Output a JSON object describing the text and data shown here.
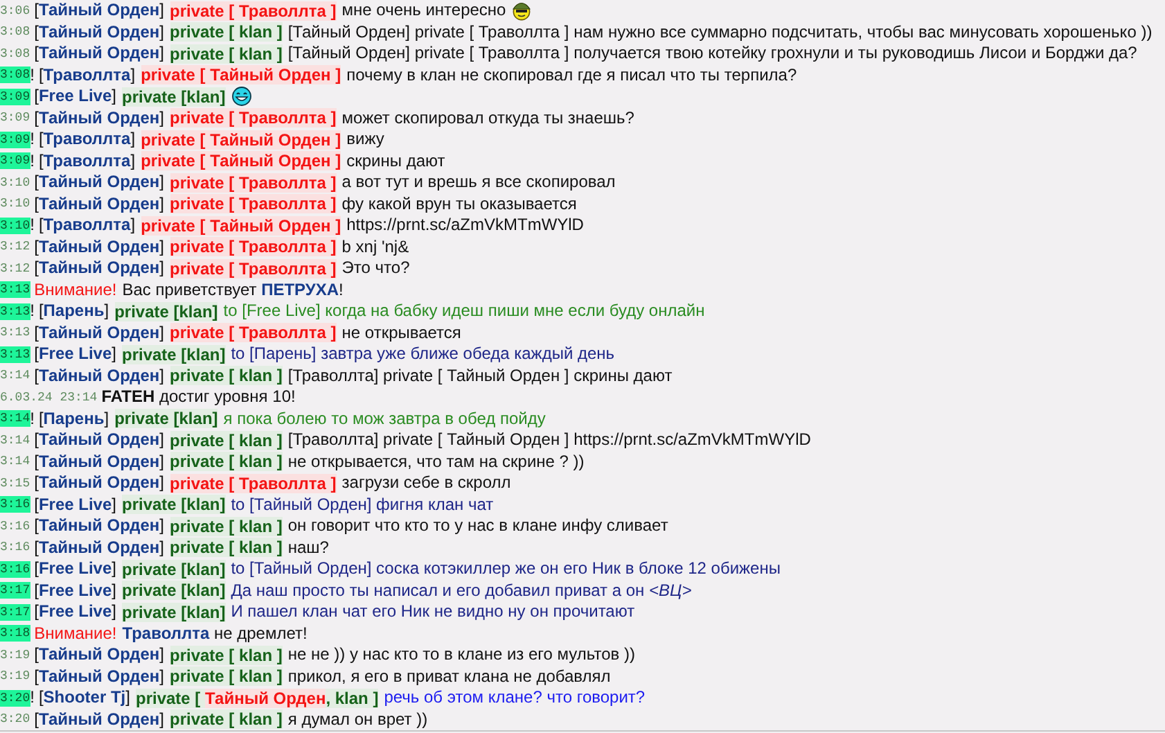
{
  "lines": [
    {
      "time": "3:06",
      "highlighted": false,
      "sender": "[Тайный Орден]",
      "tag": [
        {
          "text": "private [ Траволлта ]",
          "kind": "private"
        }
      ],
      "message": "мне очень интересно",
      "color": "#111111",
      "emoticon": {
        "kind": "helmet"
      }
    },
    {
      "time": "3:08",
      "highlighted": false,
      "sender": "[Тайный Орден]",
      "tag": [
        {
          "text": "private [ klan ]",
          "kind": "klan"
        }
      ],
      "message": "[Тайный Орден] private [ Траволлта ] нам нужно все суммарно подсчитать, чтобы вас минусовать хорошенько ))",
      "color": "#111111"
    },
    {
      "time": "3:08",
      "highlighted": false,
      "sender": "[Тайный Орден]",
      "tag": [
        {
          "text": "private [ klan ]",
          "kind": "klan"
        }
      ],
      "message": "[Тайный Орден] private [ Траволлта ] получается твою котейку грохнули и ты руководишь Лисои и Борджи да?",
      "color": "#111111"
    },
    {
      "time": "3:08",
      "highlighted": true,
      "prefix": "!",
      "sender": "[Траволлта]",
      "tag": [
        {
          "text": "private [ Тайный Орден ]",
          "kind": "private"
        }
      ],
      "message": "почему в клан не скопировал где я писал что ты терпила?",
      "color": "#111111"
    },
    {
      "time": "3:09",
      "highlighted": true,
      "sender": "[Free Live]",
      "tag": [
        {
          "text": "private [klan]",
          "kind": "klan"
        }
      ],
      "emoticon": {
        "kind": "grin"
      }
    },
    {
      "time": "3:09",
      "highlighted": false,
      "sender": "[Тайный Орден]",
      "tag": [
        {
          "text": "private [ Траволлта ]",
          "kind": "private"
        }
      ],
      "message": "может скопировал откуда ты знаешь?",
      "color": "#111111"
    },
    {
      "time": "3:09",
      "highlighted": true,
      "prefix": "!",
      "sender": "[Траволлта]",
      "tag": [
        {
          "text": "private [ Тайный Орден ]",
          "kind": "private"
        }
      ],
      "message": "вижу",
      "color": "#111111"
    },
    {
      "time": "3:09",
      "highlighted": true,
      "prefix": "!",
      "sender": "[Траволлта]",
      "tag": [
        {
          "text": "private [ Тайный Орден ]",
          "kind": "private"
        }
      ],
      "message": "скрины дают",
      "color": "#111111"
    },
    {
      "time": "3:10",
      "highlighted": false,
      "sender": "[Тайный Орден]",
      "tag": [
        {
          "text": "private [ Траволлта ]",
          "kind": "private"
        }
      ],
      "message": "а вот тут и врешь я все скопировал",
      "color": "#111111"
    },
    {
      "time": "3:10",
      "highlighted": false,
      "sender": "[Тайный Орден]",
      "tag": [
        {
          "text": "private [ Траволлта ]",
          "kind": "private"
        }
      ],
      "message": "фу какой врун ты оказывается",
      "color": "#111111"
    },
    {
      "time": "3:10",
      "highlighted": true,
      "prefix": "!",
      "sender": "[Траволлта]",
      "tag": [
        {
          "text": "private [ Тайный Орден ]",
          "kind": "private"
        }
      ],
      "message": "https://prnt.sc/aZmVkMTmWYlD",
      "color": "#111111"
    },
    {
      "time": "3:12",
      "highlighted": false,
      "sender": "[Тайный Орден]",
      "tag": [
        {
          "text": "private [ Траволлта ]",
          "kind": "private"
        }
      ],
      "message": "b xnj 'nj&",
      "color": "#111111"
    },
    {
      "time": "3:12",
      "highlighted": false,
      "sender": "[Тайный Орден]",
      "tag": [
        {
          "text": "private [ Траволлта ]",
          "kind": "private"
        }
      ],
      "message": "Это что?",
      "color": "#111111"
    },
    {
      "time": "3:13",
      "highlighted": true,
      "notice": "Внимание!",
      "message": "Вас приветствует **ПЕТРУХА**!",
      "color": "#111111"
    },
    {
      "time": "3:13",
      "highlighted": true,
      "prefix": "!",
      "sender": "[Парень]",
      "tag": [
        {
          "text": "private [klan]",
          "kind": "klan"
        }
      ],
      "message": "to [Free Live] когда на бабку идеш пиши мне если буду онлайн",
      "color": "#2a8c22"
    },
    {
      "time": "3:13",
      "highlighted": false,
      "sender": "[Тайный Орден]",
      "tag": [
        {
          "text": "private [ Траволлта ]",
          "kind": "private"
        }
      ],
      "message": "не открывается",
      "color": "#111111"
    },
    {
      "time": "3:13",
      "highlighted": true,
      "sender": "[Free Live]",
      "tag": [
        {
          "text": "private [klan]",
          "kind": "klan"
        }
      ],
      "message": "to [Парень] завтра уже ближе обеда каждый день",
      "color": "#1e2688"
    },
    {
      "time": "3:14",
      "highlighted": false,
      "sender": "[Тайный Орден]",
      "tag": [
        {
          "text": "private [ klan ]",
          "kind": "klan"
        }
      ],
      "message": "[Траволлта] private [ Тайный Орден ] скрины дают",
      "color": "#111111"
    },
    {
      "time": "6.03.24 23:14",
      "highlighted": false,
      "message": "**FATEH** достиг уровня 10!",
      "color": "#111111"
    },
    {
      "time": "3:14",
      "highlighted": true,
      "prefix": "!",
      "sender": "[Парень]",
      "tag": [
        {
          "text": "private [klan]",
          "kind": "klan"
        }
      ],
      "message": "я пока болею то мож завтра в обед пойду",
      "color": "#2a8c22"
    },
    {
      "time": "3:14",
      "highlighted": false,
      "sender": "[Тайный Орден]",
      "tag": [
        {
          "text": "private [ klan ]",
          "kind": "klan"
        }
      ],
      "message": "[Траволлта] private [ Тайный Орден ] https://prnt.sc/aZmVkMTmWYlD",
      "color": "#111111"
    },
    {
      "time": "3:14",
      "highlighted": false,
      "sender": "[Тайный Орден]",
      "tag": [
        {
          "text": "private [ klan ]",
          "kind": "klan"
        }
      ],
      "message": "не открывается, что там на скрине ? ))",
      "color": "#111111"
    },
    {
      "time": "3:15",
      "highlighted": false,
      "sender": "[Тайный Орден]",
      "tag": [
        {
          "text": "private [ Траволлта ]",
          "kind": "private"
        }
      ],
      "message": "загрузи себе в скролл",
      "color": "#111111"
    },
    {
      "time": "3:16",
      "highlighted": true,
      "sender": "[Free Live]",
      "tag": [
        {
          "text": "private [klan]",
          "kind": "klan"
        }
      ],
      "message": "to [Тайный Орден] фигня клан чат",
      "color": "#1e2688"
    },
    {
      "time": "3:16",
      "highlighted": false,
      "sender": "[Тайный Орден]",
      "tag": [
        {
          "text": "private [ klan ]",
          "kind": "klan"
        }
      ],
      "message": "он говорит что кто то у нас в клане инфу сливает",
      "color": "#111111"
    },
    {
      "time": "3:16",
      "highlighted": false,
      "sender": "[Тайный Орден]",
      "tag": [
        {
          "text": "private [ klan ]",
          "kind": "klan"
        }
      ],
      "message": "наш?",
      "color": "#111111"
    },
    {
      "time": "3:16",
      "highlighted": true,
      "sender": "[Free Live]",
      "tag": [
        {
          "text": "private [klan]",
          "kind": "klan"
        }
      ],
      "message": "to [Тайный Орден] соска котэкиллер же он его Ник в блоке 12 обижены",
      "color": "#1e2688"
    },
    {
      "time": "3:17",
      "highlighted": true,
      "sender": "[Free Live]",
      "tag": [
        {
          "text": "private [klan]",
          "kind": "klan"
        }
      ],
      "message": "Да наш просто ты написал и его добавил приват а он *<ВЦ>*",
      "color": "#1e2688"
    },
    {
      "time": "3:17",
      "highlighted": true,
      "sender": "[Free Live]",
      "tag": [
        {
          "text": "private [klan]",
          "kind": "klan"
        }
      ],
      "message": "И пашел клан чат его Ник не видно ну он прочитают",
      "color": "#1e2688"
    },
    {
      "time": "3:18",
      "highlighted": true,
      "notice": "Внимание!",
      "message": "**Траволлта** не дремлет!",
      "color": "#111111"
    },
    {
      "time": "3:19",
      "highlighted": false,
      "sender": "[Тайный Орден]",
      "tag": [
        {
          "text": "private [ klan ]",
          "kind": "klan"
        }
      ],
      "message": "не не )) у нас кто то в клане из его мультов ))",
      "color": "#111111"
    },
    {
      "time": "3:19",
      "highlighted": false,
      "sender": "[Тайный Орден]",
      "tag": [
        {
          "text": "private [ klan ]",
          "kind": "klan"
        }
      ],
      "message": "прикол, я его в приват клана не добавлял",
      "color": "#111111"
    },
    {
      "time": "3:20",
      "highlighted": true,
      "prefix": "!",
      "sender": "[Shooter Tj]",
      "tag": [
        {
          "text": "private [ ",
          "kind": "klan"
        },
        {
          "text": "Тайный Орден",
          "kind": "private"
        },
        {
          "text": ", klan ]",
          "kind": "klan"
        }
      ],
      "message": "речь об этом клане? что говорит?",
      "color": "#1c1cf0"
    },
    {
      "time": "3:20",
      "highlighted": false,
      "sender": "[Тайный Орден]",
      "tag": [
        {
          "text": "private [ klan ]",
          "kind": "klan"
        }
      ],
      "message": "я думал он врет ))",
      "color": "#111111"
    }
  ]
}
